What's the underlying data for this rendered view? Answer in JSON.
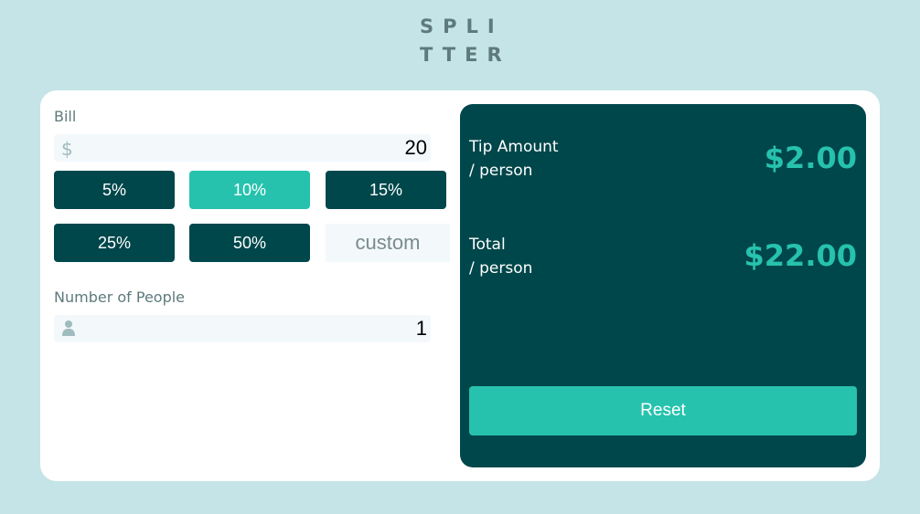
{
  "logo": {
    "line1": "SPLI",
    "line2": "TTER"
  },
  "bill": {
    "label": "Bill",
    "currency_icon": "dollar-icon",
    "value": "20"
  },
  "tips": {
    "options": [
      {
        "label": "5%"
      },
      {
        "label": "10%"
      },
      {
        "label": "15%"
      },
      {
        "label": "25%"
      },
      {
        "label": "50%"
      }
    ],
    "selected": "10%",
    "custom_placeholder": "custom"
  },
  "people": {
    "label": "Number of People",
    "person_icon": "person-icon",
    "value": "1"
  },
  "results": {
    "tip_label_1": "Tip Amount",
    "tip_label_2": "/ person",
    "tip_amount": "$2.00",
    "total_label_1": "Total",
    "total_label_2": "/ person",
    "total_amount": "$22.00",
    "reset_label": "Reset"
  },
  "colors": {
    "background": "#c5e4e7",
    "dark_cyan": "#00474b",
    "strong_cyan": "#26c2ad",
    "grey": "#5e7a7d"
  }
}
